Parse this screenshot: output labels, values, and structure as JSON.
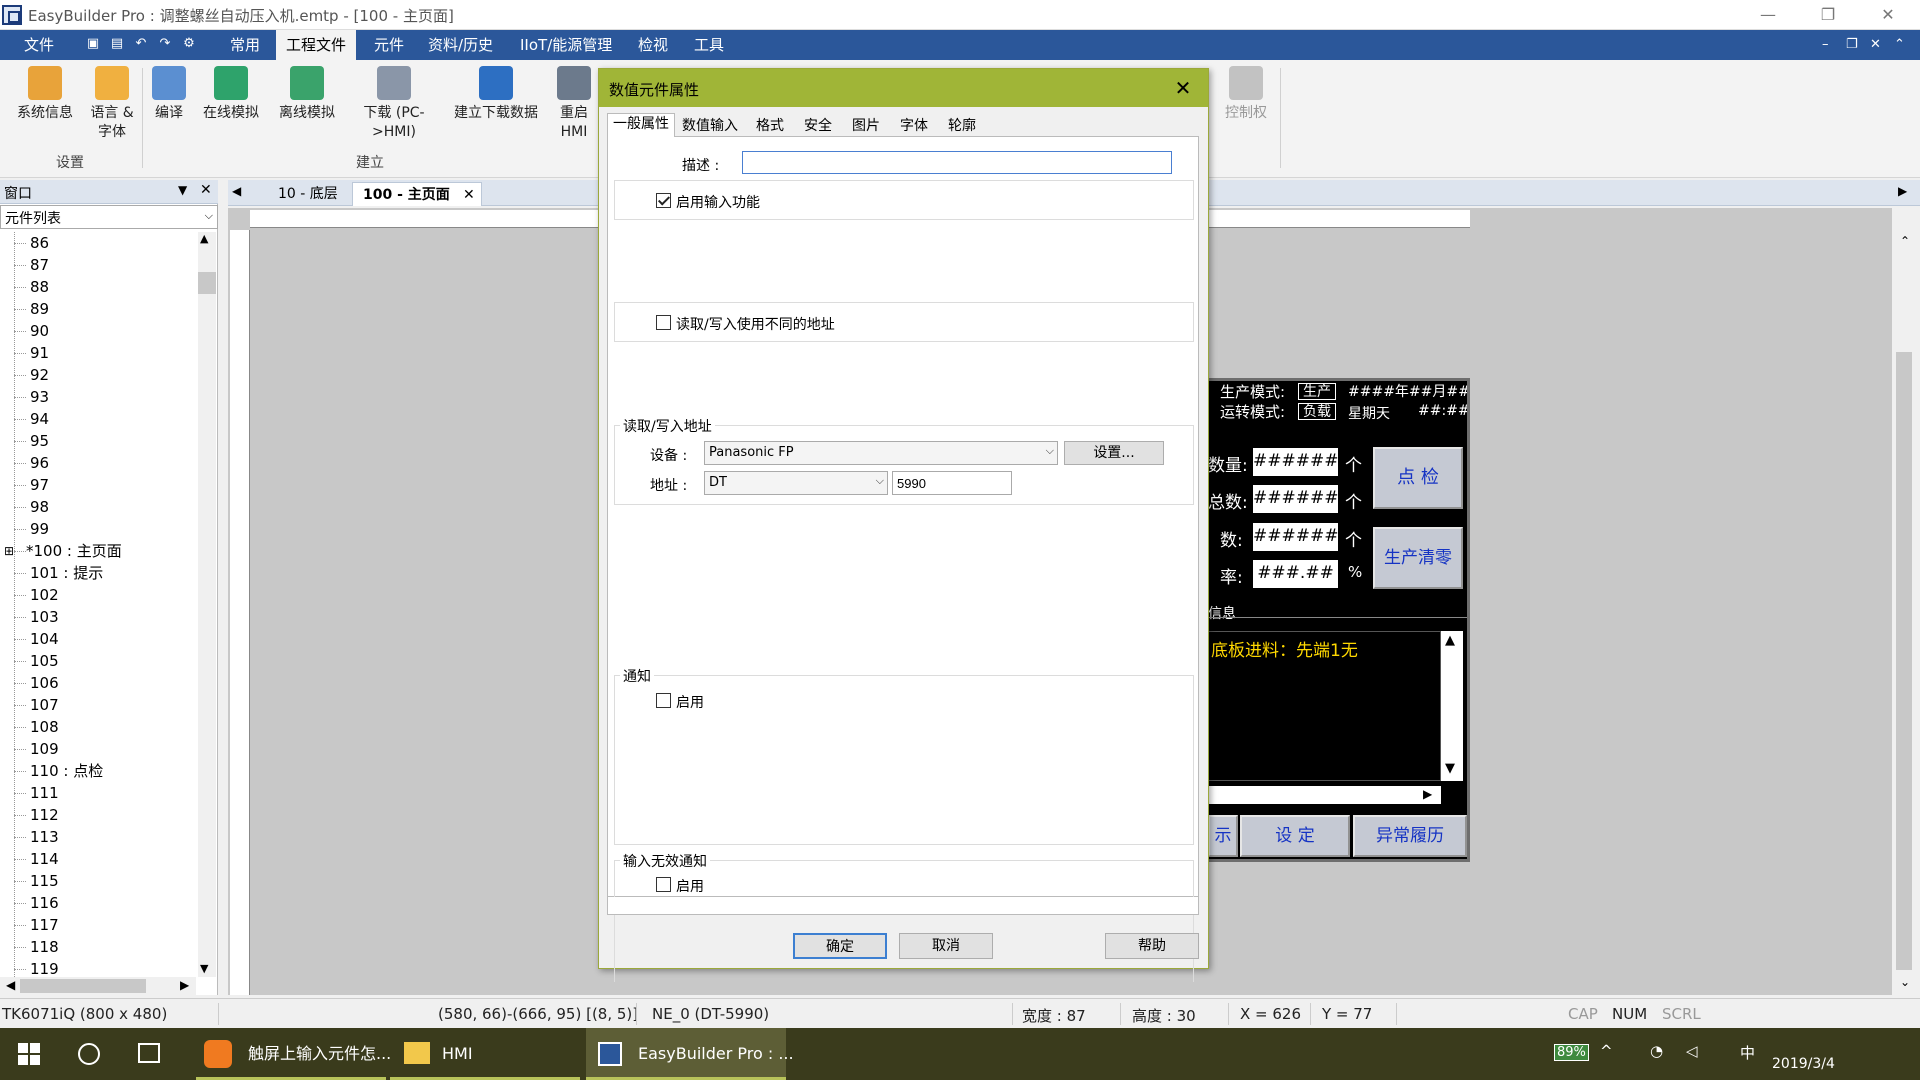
{
  "window": {
    "title": "EasyBuilder Pro : 调整螺丝自动压入机.emtp - [100 - 主页面]"
  },
  "menubar": {
    "items": [
      "文件",
      "常用",
      "工程文件",
      "元件",
      "资料/历史",
      "IIoT/能源管理",
      "检视",
      "工具"
    ],
    "active": "工程文件"
  },
  "ribbon": {
    "buttons": [
      {
        "label": "系统信息",
        "icon": "system-info-icon"
      },
      {
        "label": "语言 &",
        "label2": "字体",
        "icon": "language-font-icon"
      },
      {
        "label": "编译",
        "icon": "compile-icon"
      },
      {
        "label": "在线模拟",
        "icon": "online-sim-icon"
      },
      {
        "label": "离线模拟",
        "icon": "offline-sim-icon"
      },
      {
        "label": "下载 (PC-",
        "label2": ">HMI)",
        "icon": "download-icon"
      },
      {
        "label": "建立下载数据",
        "icon": "sd-card-icon"
      },
      {
        "label": "重启",
        "label2": "HMI",
        "icon": "restart-hmi-icon"
      },
      {
        "label": "控制权",
        "icon": "lock-icon"
      }
    ],
    "group_settings": "设置",
    "group_build": "建立"
  },
  "left_panel": {
    "title": "窗口",
    "list_type": "元件列表",
    "items": [
      "86",
      "87",
      "88",
      "89",
      "90",
      "91",
      "92",
      "93",
      "94",
      "95",
      "96",
      "97",
      "98",
      "99",
      "*100 : 主页面",
      "101 : 提示",
      "102",
      "103",
      "104",
      "105",
      "106",
      "107",
      "108",
      "109",
      "110 : 点检",
      "111",
      "112",
      "113",
      "114",
      "115",
      "116",
      "117",
      "118",
      "119"
    ]
  },
  "tabs": [
    {
      "label": "10 - 底层"
    },
    {
      "label": "100 - 主页面"
    }
  ],
  "hmi": {
    "prod_mode_label": "生产模式:",
    "prod_mode_value": "生产",
    "run_mode_label": "运转模式:",
    "run_mode_value": "负载",
    "date_line1": "####年##月##日",
    "date_line2": "星期天",
    "time_value": "##:##",
    "qty_label": "数量:",
    "total_label": "总数:",
    "num_label": "数:",
    "rate_label": "率:",
    "value_hash": "#######",
    "rate_value": "###.##",
    "unit_piece": "个",
    "percent": "%",
    "check_btn": "点 检",
    "reset_btn": "生产清零",
    "info_label": "信息",
    "message": "底板进料：先端1无",
    "nav_prefix": "示",
    "settings_btn": "设 定",
    "history_btn": "异常履历"
  },
  "dialog": {
    "title": "数值元件属性",
    "tabs": [
      "一般属性",
      "数值输入",
      "格式",
      "安全",
      "图片",
      "字体",
      "轮廓"
    ],
    "active_tab": "一般属性",
    "description_label": "描述 :",
    "description_value": "",
    "enable_input_label": "启用输入功能",
    "enable_input_checked": true,
    "diff_address_label": "读取/写入使用不同的地址",
    "diff_address_checked": false,
    "rw_group_label": "读取/写入地址",
    "device_label": "设备 :",
    "device_value": "Panasonic FP",
    "setup_btn": "设置...",
    "address_label": "地址 :",
    "address_type": "DT",
    "address_value": "5990",
    "notify_group_label": "通知",
    "notify_enable_label": "启用",
    "invalid_group_label": "输入无效通知",
    "invalid_enable_label": "启用",
    "ok_btn": "确定",
    "cancel_btn": "取消",
    "help_btn": "帮助"
  },
  "statusbar": {
    "model": "TK6071iQ (800 x 480)",
    "coords": "(580, 66)-(666, 95) [(8, 5)]",
    "element": "NE_0 (DT-5990)",
    "width": "宽度 : 87",
    "height": "高度 : 30",
    "x": "X = 626",
    "y": "Y = 77",
    "cap": "CAP",
    "num": "NUM",
    "scrl": "SCRL"
  },
  "taskbar": {
    "apps": [
      {
        "label": "触屏上输入元件怎..."
      },
      {
        "label": "HMI"
      },
      {
        "label": "EasyBuilder Pro : ..."
      }
    ],
    "battery": "89%",
    "ime": "中",
    "date": "2019/3/4"
  },
  "colors": {
    "menubar": "#2b579a",
    "dialog_titlebar": "#a0b537",
    "taskbar": "#3a3b1c",
    "hmi_text_yellow": "#ffd800",
    "hmi_button_text": "#1533c4"
  }
}
